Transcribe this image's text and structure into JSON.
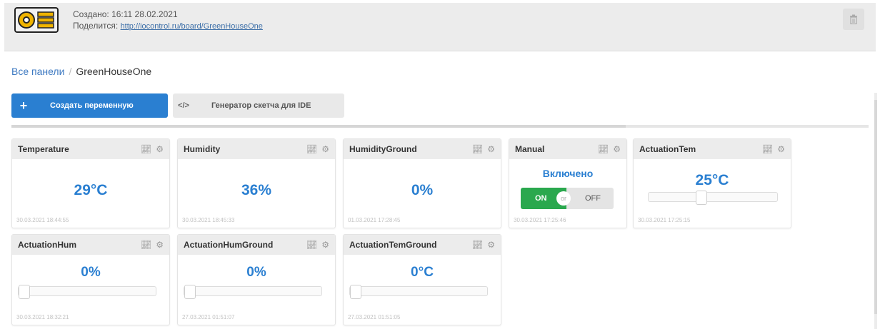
{
  "header": {
    "created": "Создано: 16:11 28.02.2021",
    "share_label": "Поделится:",
    "share_link": "http://iocontrol.ru/board/GreenHouseOne"
  },
  "breadcrumb": {
    "root": "Все панели",
    "separator": "/",
    "current": "GreenHouseOne"
  },
  "toolbar": {
    "create_label": "Создать переменную",
    "create_icon": "+",
    "generator_label": "Генератор скетча для IDE",
    "generator_icon": "</>"
  },
  "widgets": [
    {
      "title": "Temperature",
      "value": "29°C",
      "time": "30.03.2021 18:44:55"
    },
    {
      "title": "Humidity",
      "value": "36%",
      "time": "30.03.2021 18:45:33"
    },
    {
      "title": "HumidityGround",
      "value": "0%",
      "time": "01.03.2021 17:28:45"
    },
    {
      "title": "Manual",
      "state": "Включено",
      "on": "ON",
      "or": "or",
      "off": "OFF",
      "time": "30.03.2021 17:25:46"
    },
    {
      "title": "ActuationTem",
      "value": "25°C",
      "time": "30.03.2021 17:25:15",
      "slider_fraction": 0.4
    },
    {
      "title": "ActuationHum",
      "value": "0%",
      "time": "30.03.2021 18:32:21",
      "slider_fraction": 0
    },
    {
      "title": "ActuationHumGround",
      "value": "0%",
      "time": "27.03.2021 01:51:07",
      "slider_fraction": 0
    },
    {
      "title": "ActuationTemGround",
      "value": "0°C",
      "time": "27.03.2021 01:51:05",
      "slider_fraction": 0
    }
  ],
  "icons": {
    "chart": "chart-icon",
    "gear": "gear-icon",
    "trash": "trash-icon"
  },
  "colors": {
    "accent": "#2a7fd1",
    "toggle_on": "#2aa84e"
  }
}
